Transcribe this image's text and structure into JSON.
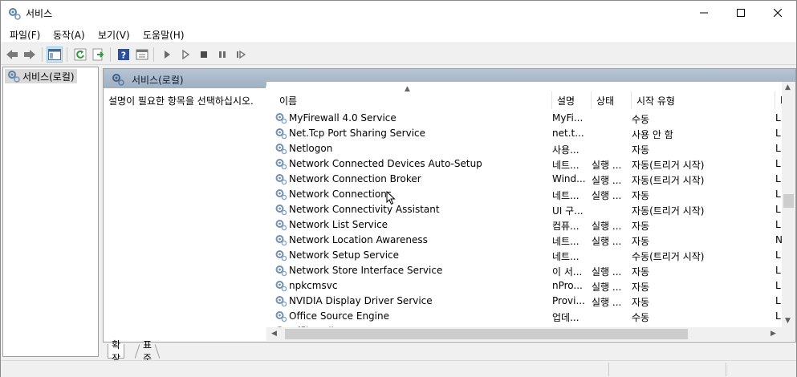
{
  "window": {
    "title": "서비스"
  },
  "menu": [
    {
      "label": "파일(F)"
    },
    {
      "label": "동작(A)"
    },
    {
      "label": "보기(V)"
    },
    {
      "label": "도움말(H)"
    }
  ],
  "tree": {
    "root_label": "서비스(로컬)"
  },
  "pane": {
    "header_title": "서비스(로컬)",
    "description_prompt": "설명이 필요한 항목을 선택하십시오."
  },
  "columns": [
    "이름",
    "설명",
    "상태",
    "시작 유형",
    "D"
  ],
  "rows": [
    {
      "name": "MyFirewall 4.0 Service",
      "desc": "MyFi...",
      "status": "",
      "start": "수동",
      "logon": "L"
    },
    {
      "name": "Net.Tcp Port Sharing Service",
      "desc": "net.t...",
      "status": "",
      "start": "사용 안 함",
      "logon": "L"
    },
    {
      "name": "Netlogon",
      "desc": "사용...",
      "status": "",
      "start": "자동",
      "logon": "L"
    },
    {
      "name": "Network Connected Devices Auto-Setup",
      "desc": "네트...",
      "status": "실행 ...",
      "start": "자동(트리거 시작)",
      "logon": "L"
    },
    {
      "name": "Network Connection Broker",
      "desc": "Wind...",
      "status": "실행 ...",
      "start": "자동(트리거 시작)",
      "logon": "L"
    },
    {
      "name": "Network Connections",
      "desc": "네트...",
      "status": "실행 ...",
      "start": "자동",
      "logon": "L"
    },
    {
      "name": "Network Connectivity Assistant",
      "desc": "UI 구...",
      "status": "",
      "start": "자동(트리거 시작)",
      "logon": "L"
    },
    {
      "name": "Network List Service",
      "desc": "컴퓨...",
      "status": "실행 ...",
      "start": "자동",
      "logon": "L"
    },
    {
      "name": "Network Location Awareness",
      "desc": "네트...",
      "status": "실행 ...",
      "start": "자동",
      "logon": "N"
    },
    {
      "name": "Network Setup Service",
      "desc": "네트...",
      "status": "",
      "start": "수동(트리거 시작)",
      "logon": "L"
    },
    {
      "name": "Network Store Interface Service",
      "desc": "이 서...",
      "status": "실행 ...",
      "start": "자동",
      "logon": "L"
    },
    {
      "name": "npkcmsvc",
      "desc": "nPro...",
      "status": "실행 ...",
      "start": "자동",
      "logon": "L"
    },
    {
      "name": "NVIDIA Display Driver Service",
      "desc": "Provi...",
      "status": "실행 ...",
      "start": "자동",
      "logon": "L"
    },
    {
      "name": "Office  Source Engine",
      "desc": "업데...",
      "status": "",
      "start": "수동",
      "logon": "L"
    },
    {
      "name": "Offline Files",
      "desc": "오프...",
      "status": "",
      "start": "수동(트리거 시작)",
      "logon": "L"
    }
  ],
  "tabs": [
    {
      "label": "확장"
    },
    {
      "label": "표준"
    }
  ]
}
